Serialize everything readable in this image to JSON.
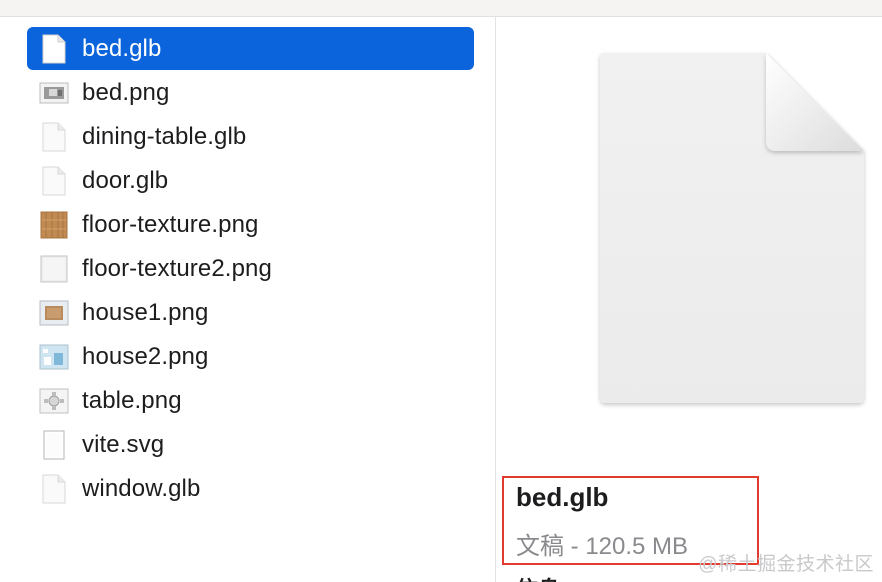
{
  "files": [
    {
      "name": "bed.glb",
      "icon": "blank-document-icon",
      "selected": true
    },
    {
      "name": "bed.png",
      "icon": "image-thumbnail-icon",
      "selected": false
    },
    {
      "name": "dining-table.glb",
      "icon": "blank-document-icon",
      "selected": false
    },
    {
      "name": "door.glb",
      "icon": "blank-document-icon",
      "selected": false
    },
    {
      "name": "floor-texture.png",
      "icon": "wood-texture-thumbnail-icon",
      "selected": false
    },
    {
      "name": "floor-texture2.png",
      "icon": "light-texture-thumbnail-icon",
      "selected": false
    },
    {
      "name": "house1.png",
      "icon": "image-thumbnail-icon",
      "selected": false
    },
    {
      "name": "house2.png",
      "icon": "image-thumbnail-icon",
      "selected": false
    },
    {
      "name": "table.png",
      "icon": "image-thumbnail-icon",
      "selected": false
    },
    {
      "name": "vite.svg",
      "icon": "svg-document-icon",
      "selected": false
    },
    {
      "name": "window.glb",
      "icon": "blank-document-icon",
      "selected": false
    }
  ],
  "preview": {
    "icon": "large-document-icon",
    "file_name": "bed.glb",
    "file_meta": "文稿 - 120.5 MB",
    "section_heading": "信息"
  },
  "watermark": "@稀土掘金技术社区",
  "colors": {
    "selection": "#0b64dc",
    "highlight_box": "#e23a2e",
    "meta_text": "#8a8a8e"
  }
}
